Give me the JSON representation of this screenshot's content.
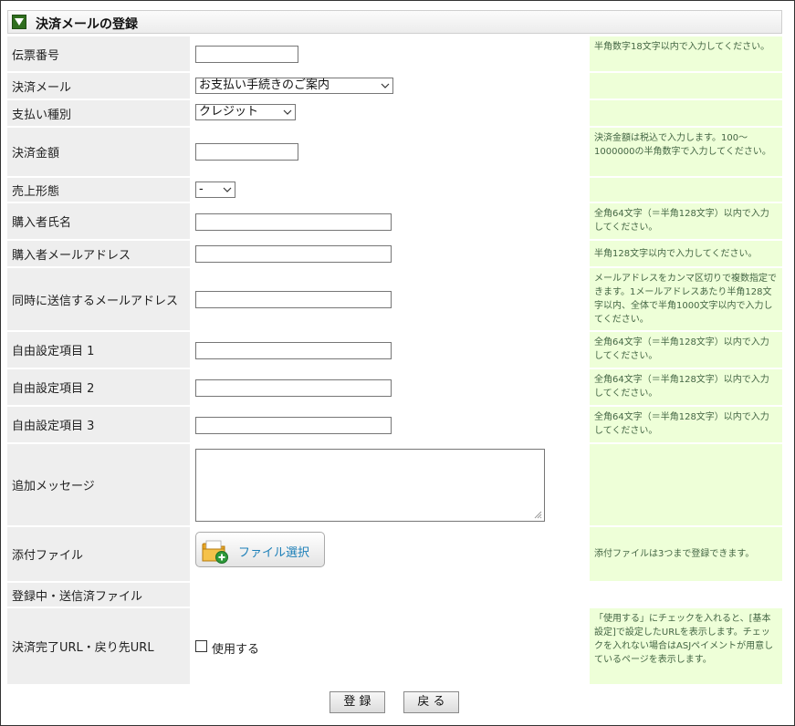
{
  "header": {
    "title": "決済メールの登録"
  },
  "rows": {
    "slip": {
      "label": "伝票番号",
      "hint": "半角数字18文字以内で入力してください。"
    },
    "mail": {
      "label": "決済メール",
      "selected": "お支払い手続きのご案内"
    },
    "paytype": {
      "label": "支払い種別",
      "selected": "クレジット"
    },
    "amount": {
      "label": "決済金額",
      "hint": "決済金額は税込で入力します。100～1000000の半角数字で入力してください。"
    },
    "saletype": {
      "label": "売上形態",
      "selected": "-"
    },
    "buyer_name": {
      "label": "購入者氏名",
      "hint": "全角64文字（＝半角128文字）以内で入力してください。"
    },
    "buyer_email": {
      "label": "購入者メールアドレス",
      "hint": "半角128文字以内で入力してください。"
    },
    "cc_email": {
      "label": "同時に送信するメールアドレス",
      "hint": "メールアドレスをカンマ区切りで複数指定できます。1メールアドレスあたり半角128文字以内、全体で半角1000文字以内で入力してください。"
    },
    "free1": {
      "label": "自由設定項目 1",
      "hint": "全角64文字（＝半角128文字）以内で入力してください。"
    },
    "free2": {
      "label": "自由設定項目 2",
      "hint": "全角64文字（＝半角128文字）以内で入力してください。"
    },
    "free3": {
      "label": "自由設定項目 3",
      "hint": "全角64文字（＝半角128文字）以内で入力してください。"
    },
    "message": {
      "label": "追加メッセージ"
    },
    "attach": {
      "label": "添付ファイル",
      "button": "ファイル選択",
      "hint": "添付ファイルは3つまで登録できます。"
    },
    "sent_files": {
      "label": "登録中・送信済ファイル"
    },
    "url": {
      "label": "決済完了URL・戻り先URL",
      "checkbox": "使用する",
      "hint": "「使用する」にチェックを入れると、[基本設定]で設定したURLを表示します。チェックを入れない場合はASJペイメントが用意しているページを表示します。"
    }
  },
  "buttons": {
    "register": "登 録",
    "back": "戻 る"
  },
  "colors": {
    "label_bg": "#eeeeee",
    "hint_bg": "#eeffd8",
    "hint_text": "#446644",
    "link_blue": "#1c7fb8",
    "header_green": "#2f6e1e"
  }
}
